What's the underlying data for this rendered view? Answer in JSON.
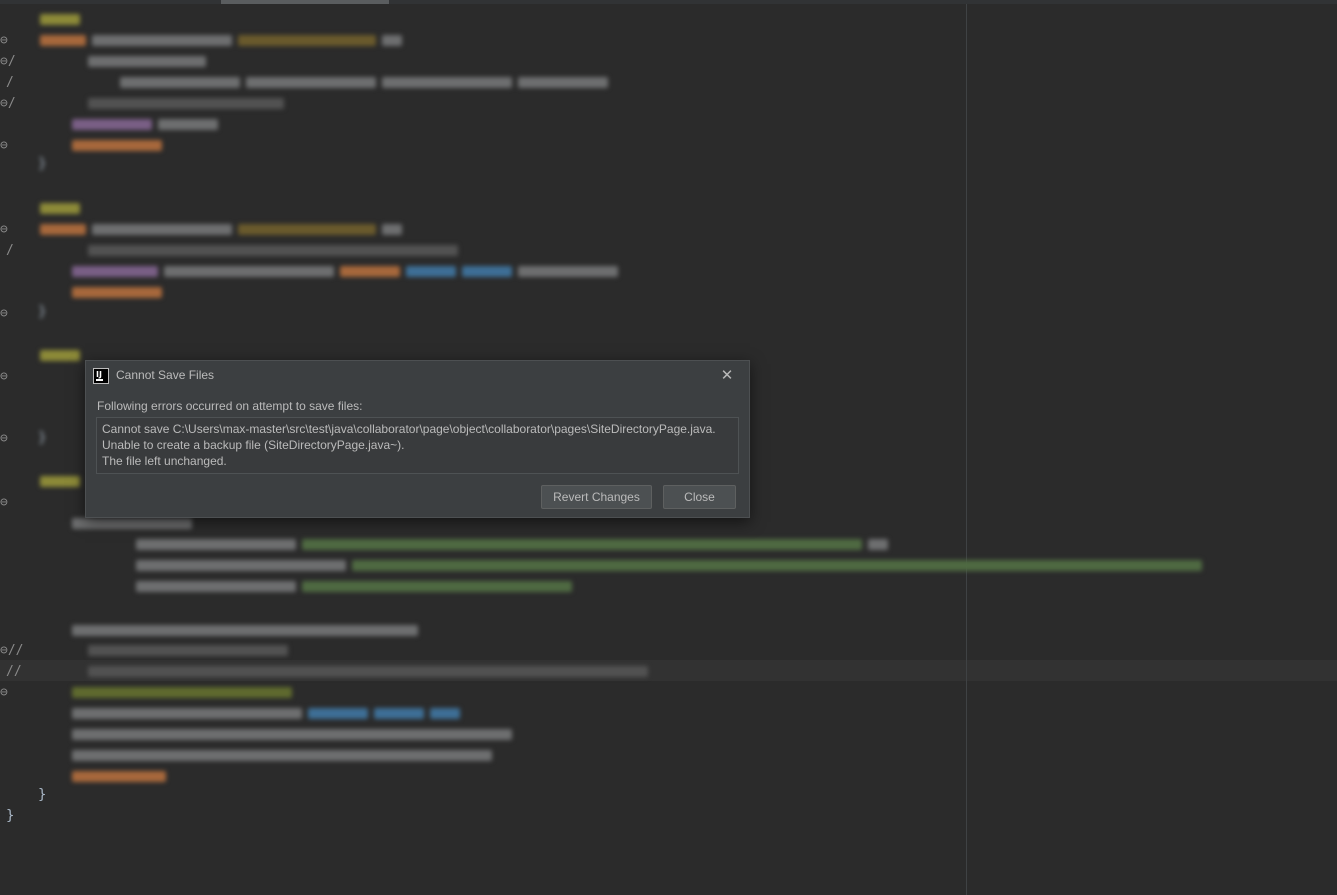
{
  "dialog": {
    "title": "Cannot Save Files",
    "app_icon_text": "IJ",
    "close_glyph": "✕",
    "message": "Following errors occurred on attempt to save files:",
    "errors": [
      "Cannot save C:\\Users\\max-master\\src\\test\\java\\collaborator\\page\\object\\collaborator\\pages\\SiteDirectoryPage.java.",
      "Unable to create a backup file (SiteDirectoryPage.java~).",
      "The file left unchanged."
    ],
    "buttons": {
      "revert": "Revert Changes",
      "close": "Close"
    }
  },
  "editor": {
    "gutter_marks": [
      "⊖",
      "⊖/",
      "/",
      "⊖/",
      "⊖",
      "⊖",
      "/",
      "⊖",
      "⊖",
      "⊖",
      "⊖",
      "⊖//",
      "//",
      "⊖"
    ],
    "closing_braces": [
      "}",
      "}"
    ]
  },
  "colors": {
    "editor_bg": "#2b2b2b",
    "dialog_bg": "#3c3f41",
    "button_bg": "#4c5052",
    "text": "#bbbbbb"
  }
}
